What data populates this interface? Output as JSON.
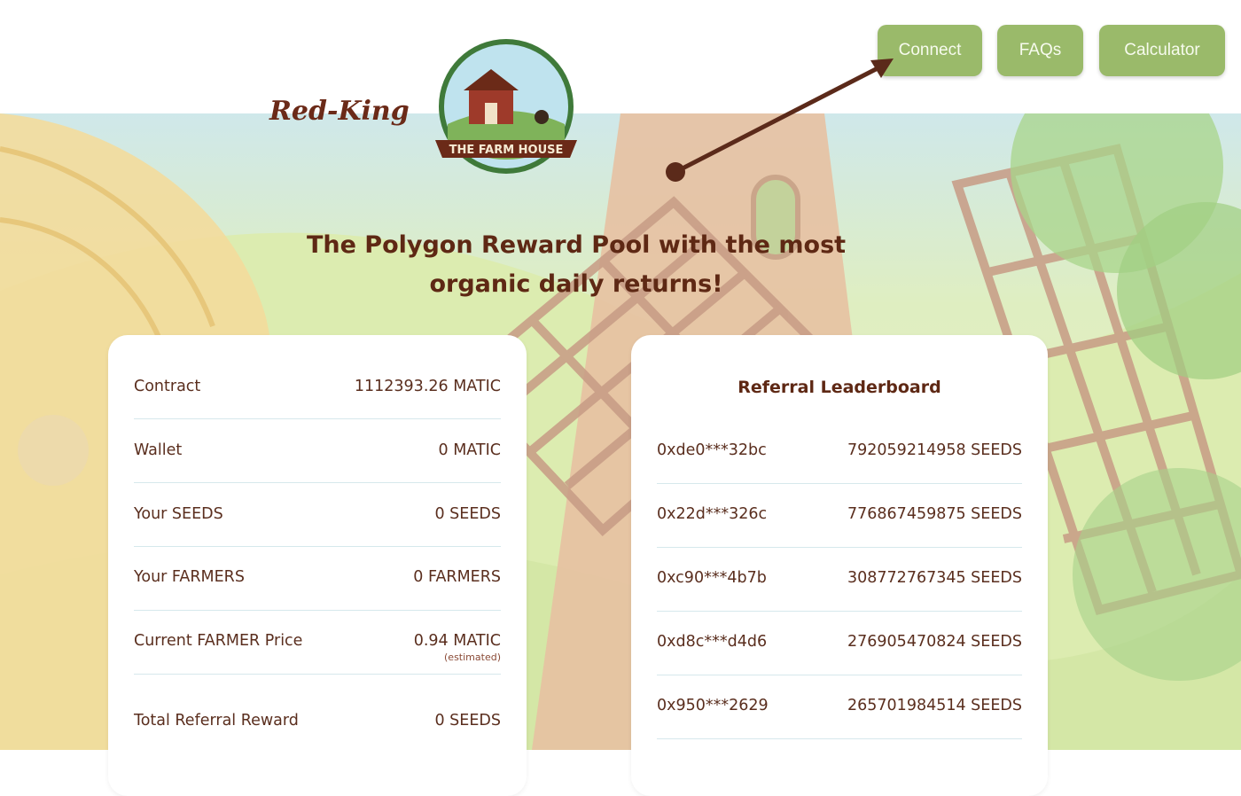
{
  "header": {
    "brand_user": "Red-King",
    "logo_text": "THE FARM HOUSE",
    "nav": {
      "connect": "Connect",
      "faqs": "FAQs",
      "calculator": "Calculator"
    }
  },
  "hero": {
    "headline_line1": "The Polygon Reward Pool with the most",
    "headline_line2": "organic daily returns!"
  },
  "stats": {
    "rows": [
      {
        "label": "Contract",
        "value": "1112393.26 MATIC"
      },
      {
        "label": "Wallet",
        "value": "0 MATIC"
      },
      {
        "label": "Your SEEDS",
        "value": "0 SEEDS"
      },
      {
        "label": "Your FARMERS",
        "value": "0 FARMERS"
      },
      {
        "label": "Current FARMER Price",
        "value": "0.94 MATIC",
        "note": "(estimated)"
      },
      {
        "label": "Total Referral Reward",
        "value": "0 SEEDS"
      }
    ]
  },
  "leaderboard": {
    "title": "Referral Leaderboard",
    "rows": [
      {
        "address": "0xde0***32bc",
        "seeds": "792059214958 SEEDS"
      },
      {
        "address": "0x22d***326c",
        "seeds": "776867459875 SEEDS"
      },
      {
        "address": "0xc90***4b7b",
        "seeds": "308772767345 SEEDS"
      },
      {
        "address": "0xd8c***d4d6",
        "seeds": "276905470824 SEEDS"
      },
      {
        "address": "0x950***2629",
        "seeds": "265701984514 SEEDS"
      }
    ]
  },
  "colors": {
    "accent": "#9aba6a",
    "brand_text": "#5e2814",
    "arrow": "#5b2a1a"
  }
}
